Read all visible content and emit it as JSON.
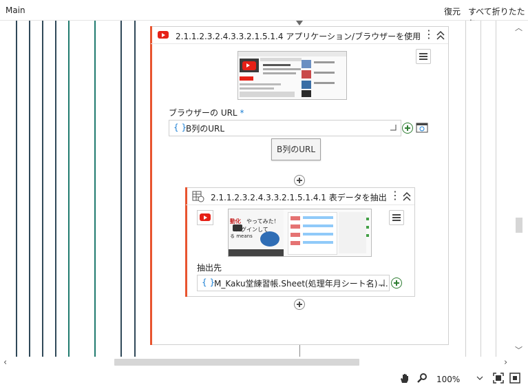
{
  "topbar": {
    "title": "Main",
    "restore_label": "復元",
    "collapse_all_label": "すべて折りたたむ"
  },
  "outer_activity": {
    "title": "2.1.1.2.3.2.4.3.3.2.1.5.1.4 アプリケーション/ブラウザーを使用",
    "browser_url_label": "ブラウザーの URL",
    "required_mark": "*",
    "url_value": "B列のURL",
    "tooltip": "B列のURL"
  },
  "inner_activity": {
    "title": "2.1.1.2.3.2.4.3.3.2.1.5.1.4.1 表データを抽出",
    "target_label": "抽出先",
    "target_value": "M_Kaku堂練習帳.Sheet(処理年月シート名) ...",
    "thumb_text_1": "動化",
    "thumb_text_2": "やってみた！",
    "thumb_text_3": "ログインして",
    "thumb_text_4": "る means"
  },
  "zoom": {
    "value": "100%"
  },
  "colors": {
    "accent": "#e8542f",
    "youtube_red": "#e62117",
    "brace_blue": "#1a7fd4",
    "lane_dark": "#2f4858",
    "lane_teal": "#1f7a6e"
  }
}
